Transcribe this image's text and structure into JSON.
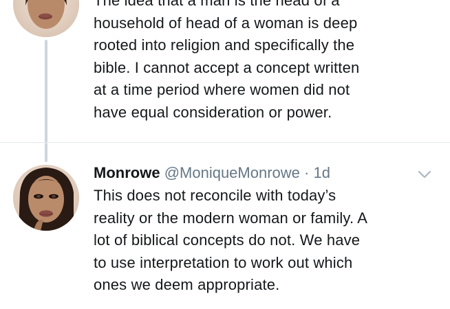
{
  "tweets": [
    {
      "text": "The idea that a man is the head of a\nhousehold of head of a woman is deep\nrooted into religion and specifically the\nbible. I cannot accept a concept written\nat a time period where women did not\nhave equal consideration or power."
    },
    {
      "display_name": "Monrowe",
      "handle": "@MoniqueMonrowe",
      "separator": "·",
      "time": "1d",
      "text": "This does not reconcile with today’s\nreality or the modern woman or family. A\nlot of biblical concepts do not. We have\nto use interpretation to work out which\nones we deem appropriate."
    }
  ],
  "icons": {
    "avatar": "avatar-photo",
    "menu": "chevron-down-icon"
  },
  "colors": {
    "text": "#14171a",
    "secondary": "#657786",
    "thread_line": "#ccd6dd",
    "divider": "#e1e8ed"
  }
}
